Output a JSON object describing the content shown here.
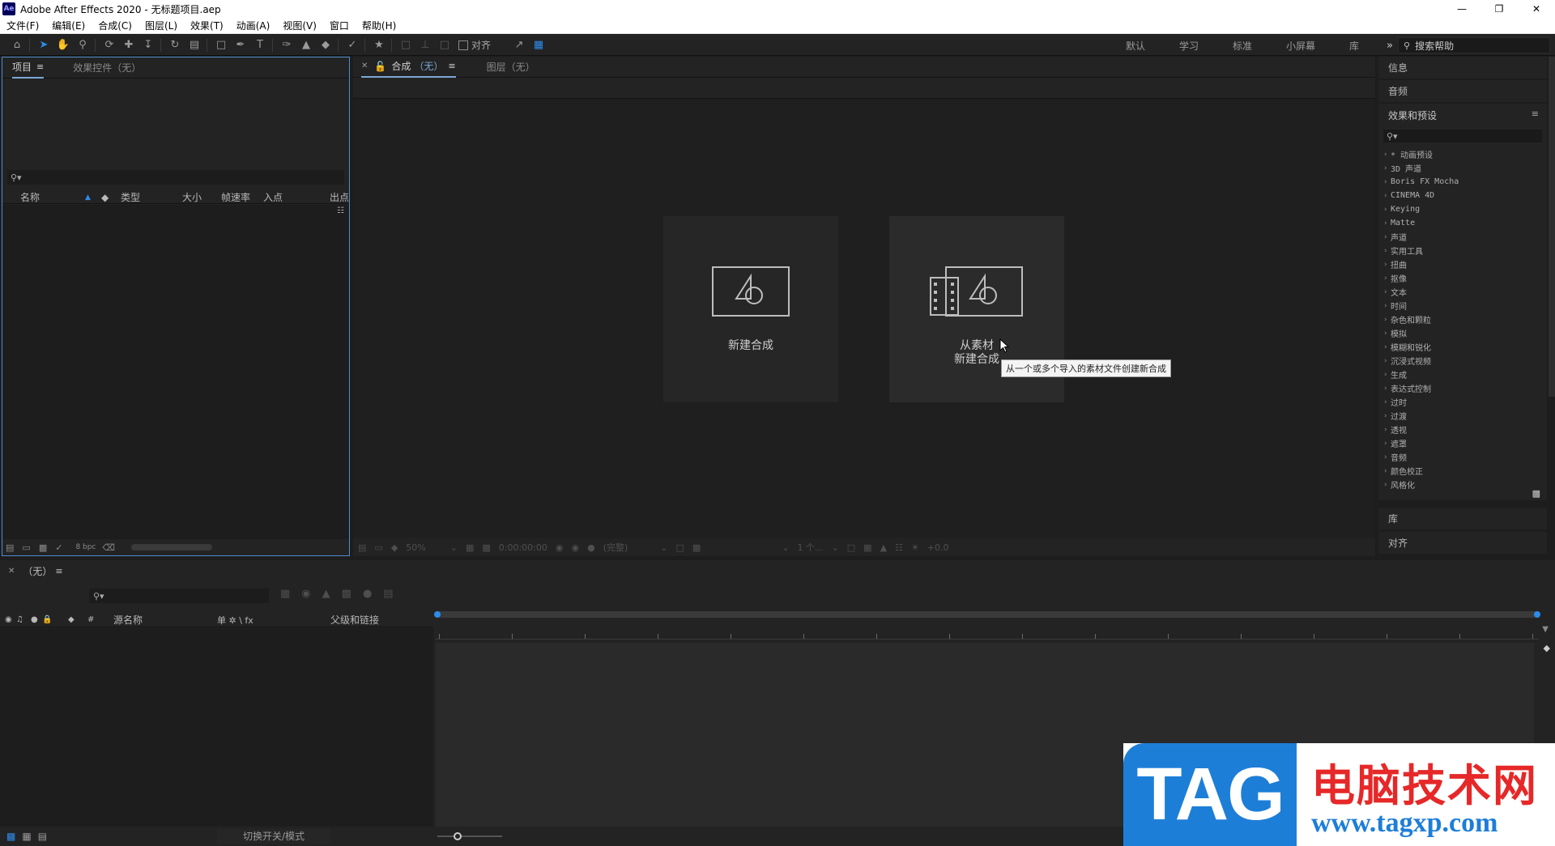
{
  "window": {
    "app_icon": "Ae",
    "title": "Adobe After Effects 2020 - 无标题项目.aep",
    "controls": [
      "minimize-icon",
      "restore-icon",
      "close-icon"
    ]
  },
  "menu": {
    "items": [
      "文件(F)",
      "编辑(E)",
      "合成(C)",
      "图层(L)",
      "效果(T)",
      "动画(A)",
      "视图(V)",
      "窗口",
      "帮助(H)"
    ]
  },
  "toolbar": {
    "align_label": "对齐",
    "workspaces": [
      "默认",
      "学习",
      "标准",
      "小屏幕",
      "库"
    ],
    "more": "»",
    "search_help_placeholder": "搜索帮助"
  },
  "project_panel": {
    "tabs": [
      "项目",
      "效果控件（无）"
    ],
    "columns": [
      "名称",
      "类型",
      "大小",
      "帧速率",
      "入点",
      "出点"
    ],
    "bpc": "8 bpc"
  },
  "comp_panel": {
    "tabs": [
      "合成",
      "（无）",
      "图层（无）"
    ],
    "card_new": "新建合成",
    "card_from_footage_line1": "从素材",
    "card_from_footage_line2": "新建合成",
    "tooltip": "从一个或多个导入的素材文件创建新合成",
    "footer_zoom": "50%",
    "footer_time": "0:00:00:00",
    "footer_quality": "(完整)",
    "footer_view": "1 个...",
    "footer_exposure": "+0.0"
  },
  "right_panels": {
    "info": "信息",
    "audio": "音频",
    "effects_title": "效果和预设",
    "effects": [
      "* 动画预设",
      "3D 声道",
      "Boris FX Mocha",
      "CINEMA 4D",
      "Keying",
      "Matte",
      "声道",
      "实用工具",
      "扭曲",
      "抠像",
      "文本",
      "时间",
      "杂色和颗粒",
      "模拟",
      "模糊和锐化",
      "沉浸式视频",
      "生成",
      "表达式控制",
      "过时",
      "过渡",
      "透视",
      "遮罩",
      "音频",
      "颜色校正",
      "风格化"
    ],
    "library": "库",
    "align": "对齐"
  },
  "timeline": {
    "tab": "（无）",
    "columns": [
      "#",
      "源名称",
      "单 ✲ \\ fx",
      "父级和链接"
    ],
    "switch_mode": "切换开关/模式"
  },
  "watermark": {
    "logo": "TAG",
    "site_name": "电脑技术网",
    "url": "www.tagxp.com"
  },
  "colors": {
    "accent": "#2d8ceb",
    "panel": "#232323",
    "background": "#1d1d1d"
  }
}
